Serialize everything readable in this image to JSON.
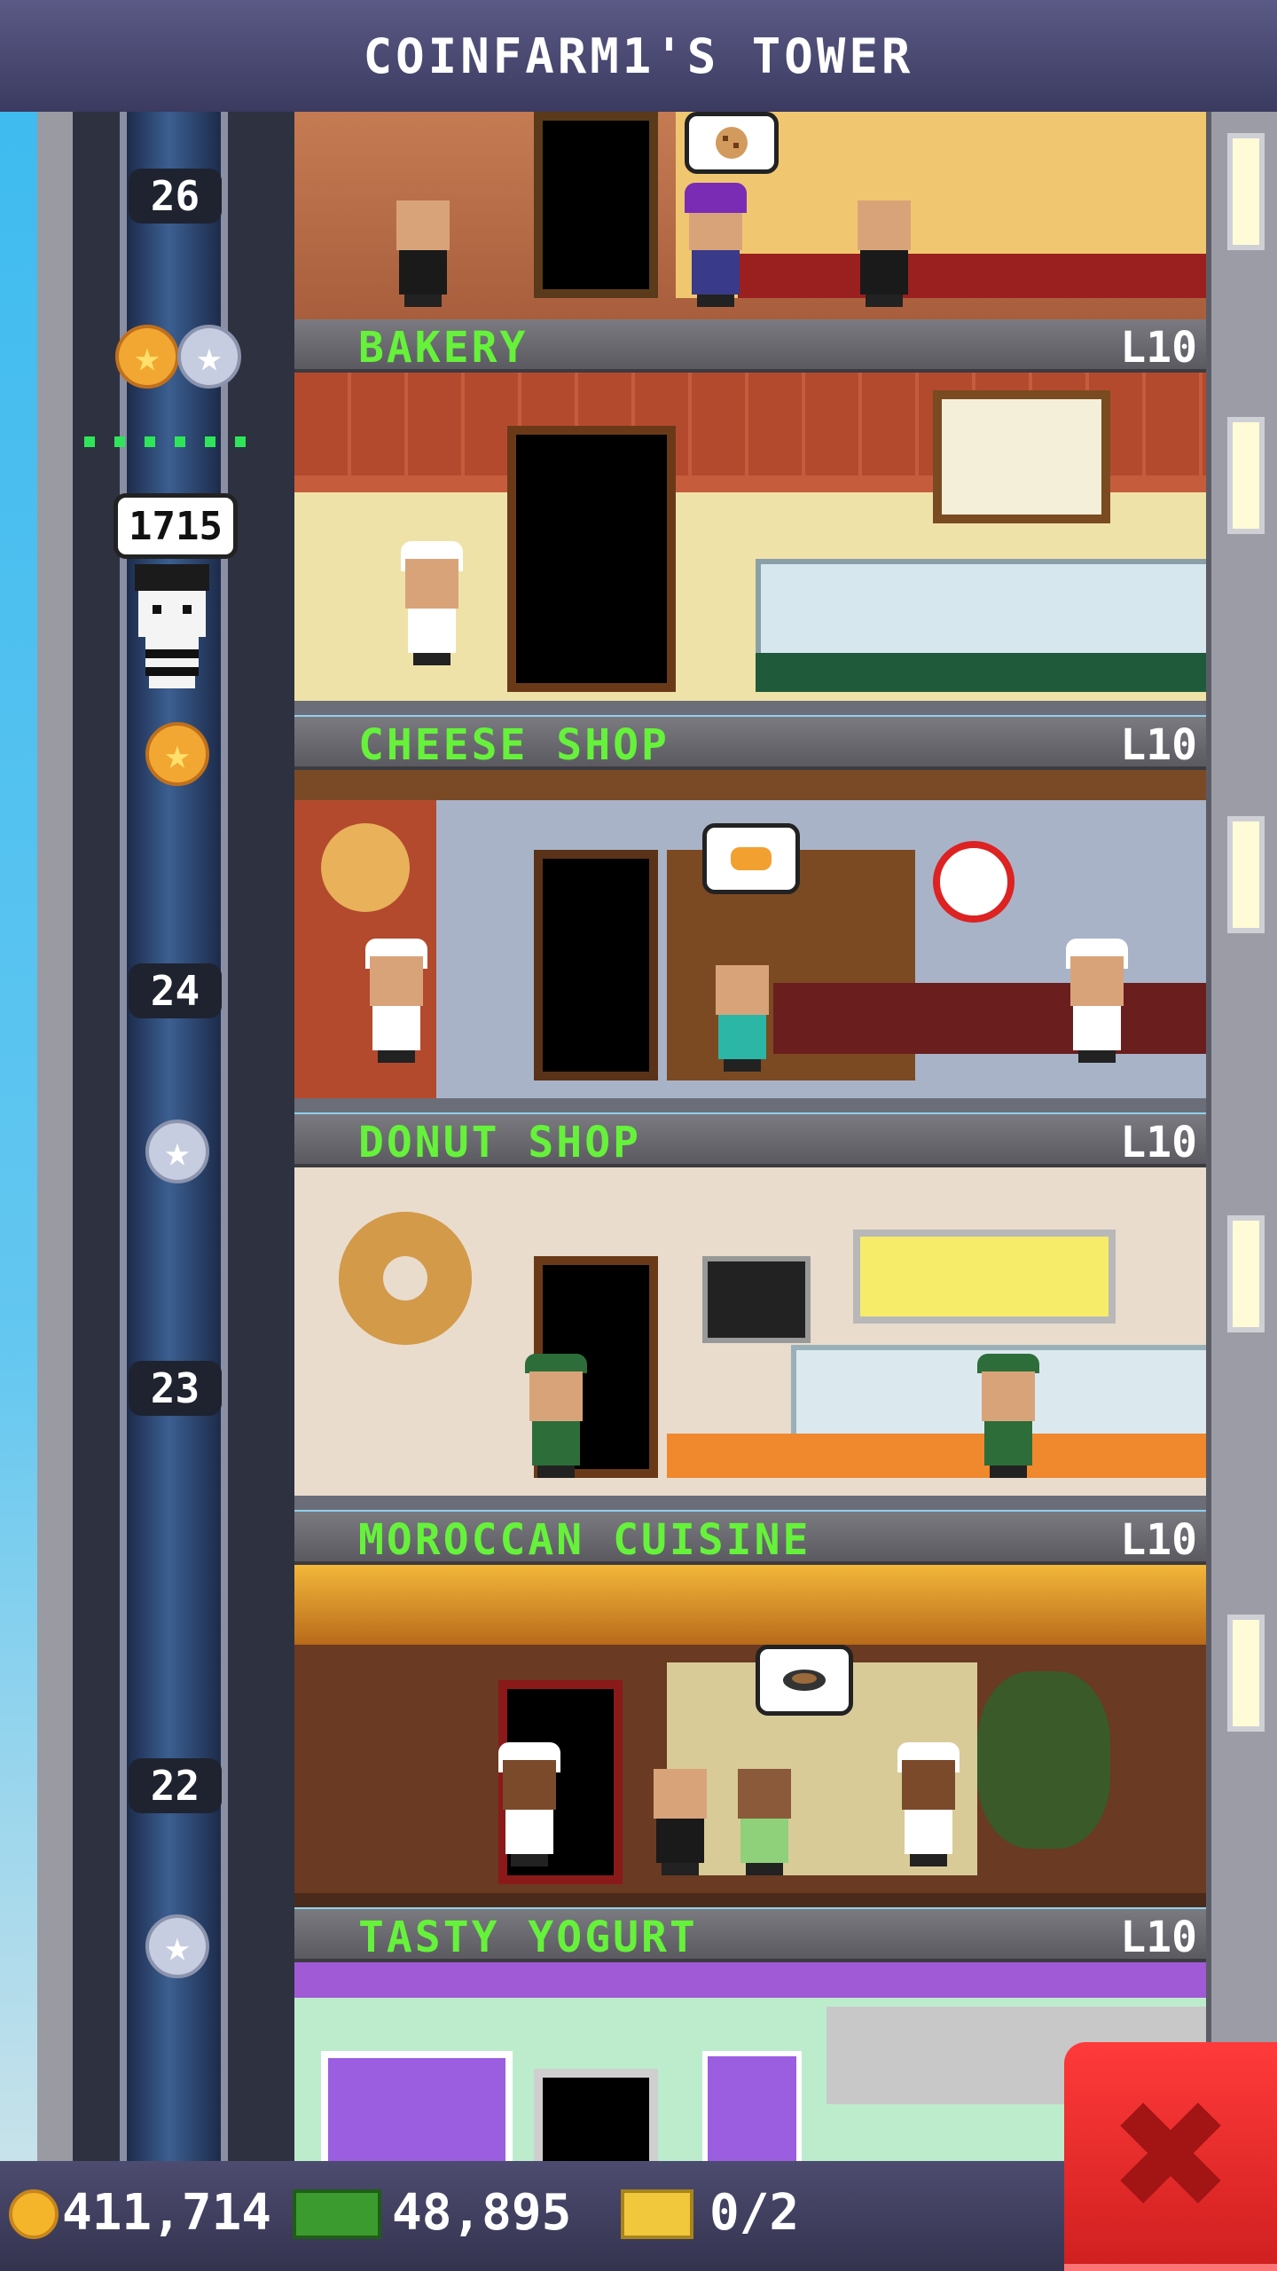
{
  "header": {
    "title": "COINFARM1'S TOWER"
  },
  "elevator": {
    "floor_numbers": [
      "26",
      "24",
      "23",
      "22"
    ],
    "passenger_bubble": "1715"
  },
  "floors": [
    {
      "name": "BAKERY",
      "level": "L10"
    },
    {
      "name": "CHEESE SHOP",
      "level": "L10"
    },
    {
      "name": "DONUT SHOP",
      "level": "L10"
    },
    {
      "name": "MOROCCAN CUISINE",
      "level": "L10"
    },
    {
      "name": "TASTY YOGURT",
      "level": "L10"
    }
  ],
  "currency": {
    "coins": "411,714",
    "bux": "48,895",
    "tickets": "0/2"
  },
  "colors": {
    "floor_name": "#66f23a",
    "header_bg": "#4a4970",
    "close_button": "#e52a2a"
  },
  "icons": {
    "coin": "coin-icon",
    "bux": "bux-icon",
    "ticket": "golden-ticket-icon",
    "close": "close-icon",
    "star_gold": "gold-star-icon",
    "star_silver": "silver-star-icon"
  }
}
